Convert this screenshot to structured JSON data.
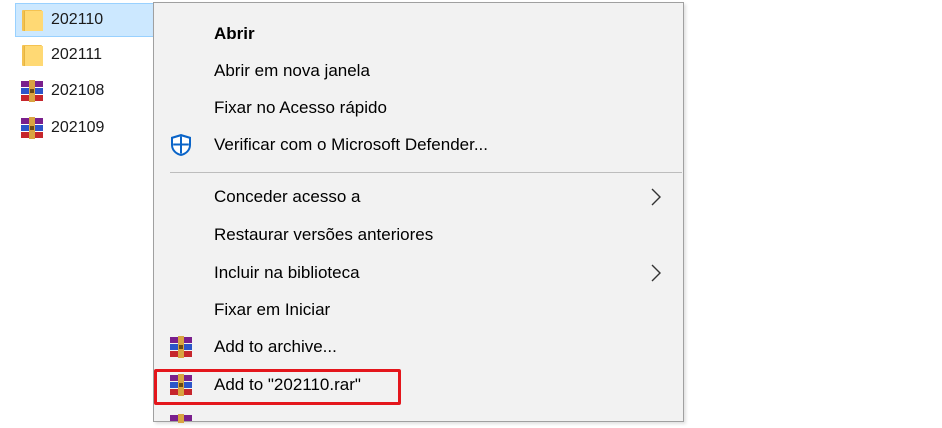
{
  "files": [
    {
      "name": "202110",
      "icon": "folder-icon",
      "selected": true
    },
    {
      "name": "202111",
      "icon": "folder-icon",
      "selected": false
    },
    {
      "name": "202108",
      "icon": "winrar-archive-icon",
      "selected": false
    },
    {
      "name": "202109",
      "icon": "winrar-archive-icon",
      "selected": false
    }
  ],
  "context_menu": {
    "items": [
      {
        "label": "Abrir",
        "bold": true,
        "icon": null,
        "submenu": false
      },
      {
        "label": "Abrir em nova janela",
        "bold": false,
        "icon": null,
        "submenu": false
      },
      {
        "label": "Fixar no Acesso rápido",
        "bold": false,
        "icon": null,
        "submenu": false
      },
      {
        "label": "Verificar com o Microsoft Defender...",
        "bold": false,
        "icon": "defender-shield-icon",
        "submenu": false
      },
      {
        "label": "Conceder acesso a",
        "bold": false,
        "icon": null,
        "submenu": true
      },
      {
        "label": "Restaurar versões anteriores",
        "bold": false,
        "icon": null,
        "submenu": false
      },
      {
        "label": "Incluir na biblioteca",
        "bold": false,
        "icon": null,
        "submenu": true
      },
      {
        "label": "Fixar em Iniciar",
        "bold": false,
        "icon": null,
        "submenu": false
      },
      {
        "label": "Add to archive...",
        "bold": false,
        "icon": "winrar-icon",
        "submenu": false
      },
      {
        "label": "Add to \"202110.rar\"",
        "bold": false,
        "icon": "winrar-icon",
        "submenu": false,
        "highlighted": true
      }
    ]
  },
  "colors": {
    "selection_bg": "#cce8ff",
    "selection_border": "#99d1ff",
    "menu_bg": "#f2f2f2",
    "highlight_border": "#e4161c",
    "defender_blue": "#0a64c8"
  }
}
